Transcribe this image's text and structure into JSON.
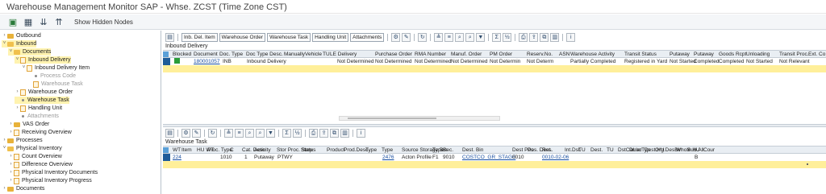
{
  "app": {
    "title": "Warehouse Management Monitor SAP - Whse. ZCST (Time Zone CST)",
    "toolbar": {
      "show_hidden_label": "Show Hidden Nodes"
    }
  },
  "tree": [
    {
      "label": "Outbound",
      "level": 0,
      "kind": "folder",
      "arrow": "›"
    },
    {
      "label": "Inbound",
      "level": 0,
      "kind": "folder-open",
      "arrow": "˅",
      "selected": true
    },
    {
      "label": "Documents",
      "level": 1,
      "kind": "folder-open",
      "arrow": "˅",
      "selected": true
    },
    {
      "label": "Inbound Delivery",
      "level": 2,
      "kind": "doc",
      "arrow": "˅",
      "selected": true
    },
    {
      "label": "Inbound Delivery Item",
      "level": 3,
      "kind": "doc",
      "arrow": "˅"
    },
    {
      "label": "Process Code",
      "level": 4,
      "kind": "doc-dot",
      "grey": true
    },
    {
      "label": "Warehouse Task",
      "level": 4,
      "kind": "doc-arrow",
      "grey": true
    },
    {
      "label": "Warehouse Order",
      "level": 2,
      "kind": "doc",
      "arrow": "›"
    },
    {
      "label": "Warehouse Task",
      "level": 2,
      "kind": "doc-dot",
      "selected": true
    },
    {
      "label": "Handling Unit",
      "level": 2,
      "kind": "doc",
      "arrow": "›"
    },
    {
      "label": "Attachments",
      "level": 2,
      "kind": "doc-dot",
      "grey": true
    },
    {
      "label": "VAS Order",
      "level": 1,
      "kind": "folder",
      "arrow": "›"
    },
    {
      "label": "Receiving Overview",
      "level": 1,
      "kind": "doc",
      "arrow": "›"
    },
    {
      "label": "Processes",
      "level": 0,
      "kind": "folder",
      "arrow": "›"
    },
    {
      "label": "Physical Inventory",
      "level": 0,
      "kind": "folder-open",
      "arrow": "˅"
    },
    {
      "label": "Count Overview",
      "level": 1,
      "kind": "doc",
      "arrow": "›"
    },
    {
      "label": "Difference Overview",
      "level": 1,
      "kind": "doc",
      "arrow": "›"
    },
    {
      "label": "Physical Inventory Documents",
      "level": 1,
      "kind": "doc",
      "arrow": "›"
    },
    {
      "label": "Physical Inventory Progress",
      "level": 1,
      "kind": "doc",
      "arrow": "›"
    },
    {
      "label": "Documents",
      "level": 0,
      "kind": "folder",
      "arrow": "›"
    }
  ],
  "top_pane": {
    "buttons": [
      "Inb. Del. Item",
      "Warehouse Order",
      "Warehouse Task",
      "Handling Unit",
      "Attachments"
    ],
    "title": "Inbound Delivery",
    "columns": [
      "Blocked",
      "Document",
      "Doc. Type",
      "Doc Type Desc.",
      "Manually",
      "Vehicle",
      "TU",
      "LE Delivery",
      "Purchase Order",
      "RMA Number",
      "Manuf. Order",
      "PM Order",
      "Reserv.No.",
      "ASN",
      "Warehouse Activity",
      "Transit Status",
      "Putaway",
      "Putaway",
      "Goods Rcpt",
      "Unloading",
      "Transit Proc.",
      "Ext. Co"
    ],
    "row": {
      "document": "180001057",
      "doc_type": "INB",
      "doc_type_desc": "Inbound Delivery",
      "le_delivery": "Not Determined",
      "purchase_order": "Not Determined",
      "rma_number": "Not Determined",
      "manuf_order": "Not Determined",
      "pm_order": "Not Determin",
      "reserv_no": "Not Determ",
      "warehouse_activity": "Partially Completed",
      "transit_status": "Registered in Yard",
      "putaway1": "Not Started",
      "putaway2": "Completed",
      "goods_rcpt": "Completed",
      "unloading": "Not Started",
      "transit_proc": "Not Relevant"
    }
  },
  "bottom_pane": {
    "title": "Warehouse Task",
    "columns": [
      "WT",
      "Item",
      "HU WT",
      "Proc. Type",
      "C",
      "Cat. Desc.",
      "Activity",
      "Stor Proc. Step",
      "Status",
      "Product",
      "Prod.Desc.",
      "Type",
      "Type",
      "Source Storage Bin",
      "Type",
      "Sec.",
      "Dest. Bin",
      "Dest Pos",
      "Pos. Dest.",
      "Res.",
      "Int.Dst.",
      "TU",
      "Dest.",
      "TU",
      "DstCarrier",
      "DLocTyp",
      "Dest.HU",
      "Org.DesBin",
      "Whole HU",
      "Sub.All",
      "Cour"
    ],
    "row": {
      "wt": "224",
      "proc_type": "1010",
      "c": "1",
      "cat_desc": "Putaway",
      "activity": "PTWY",
      "product": "2476",
      "prod_desc": "Acton Profile",
      "type1": "F1",
      "type2": "9010",
      "source_bin": "COSTCO_GR_STAGE",
      "type3": "0010",
      "dest_bin": "0010-02-06",
      "dloc": "B"
    }
  }
}
